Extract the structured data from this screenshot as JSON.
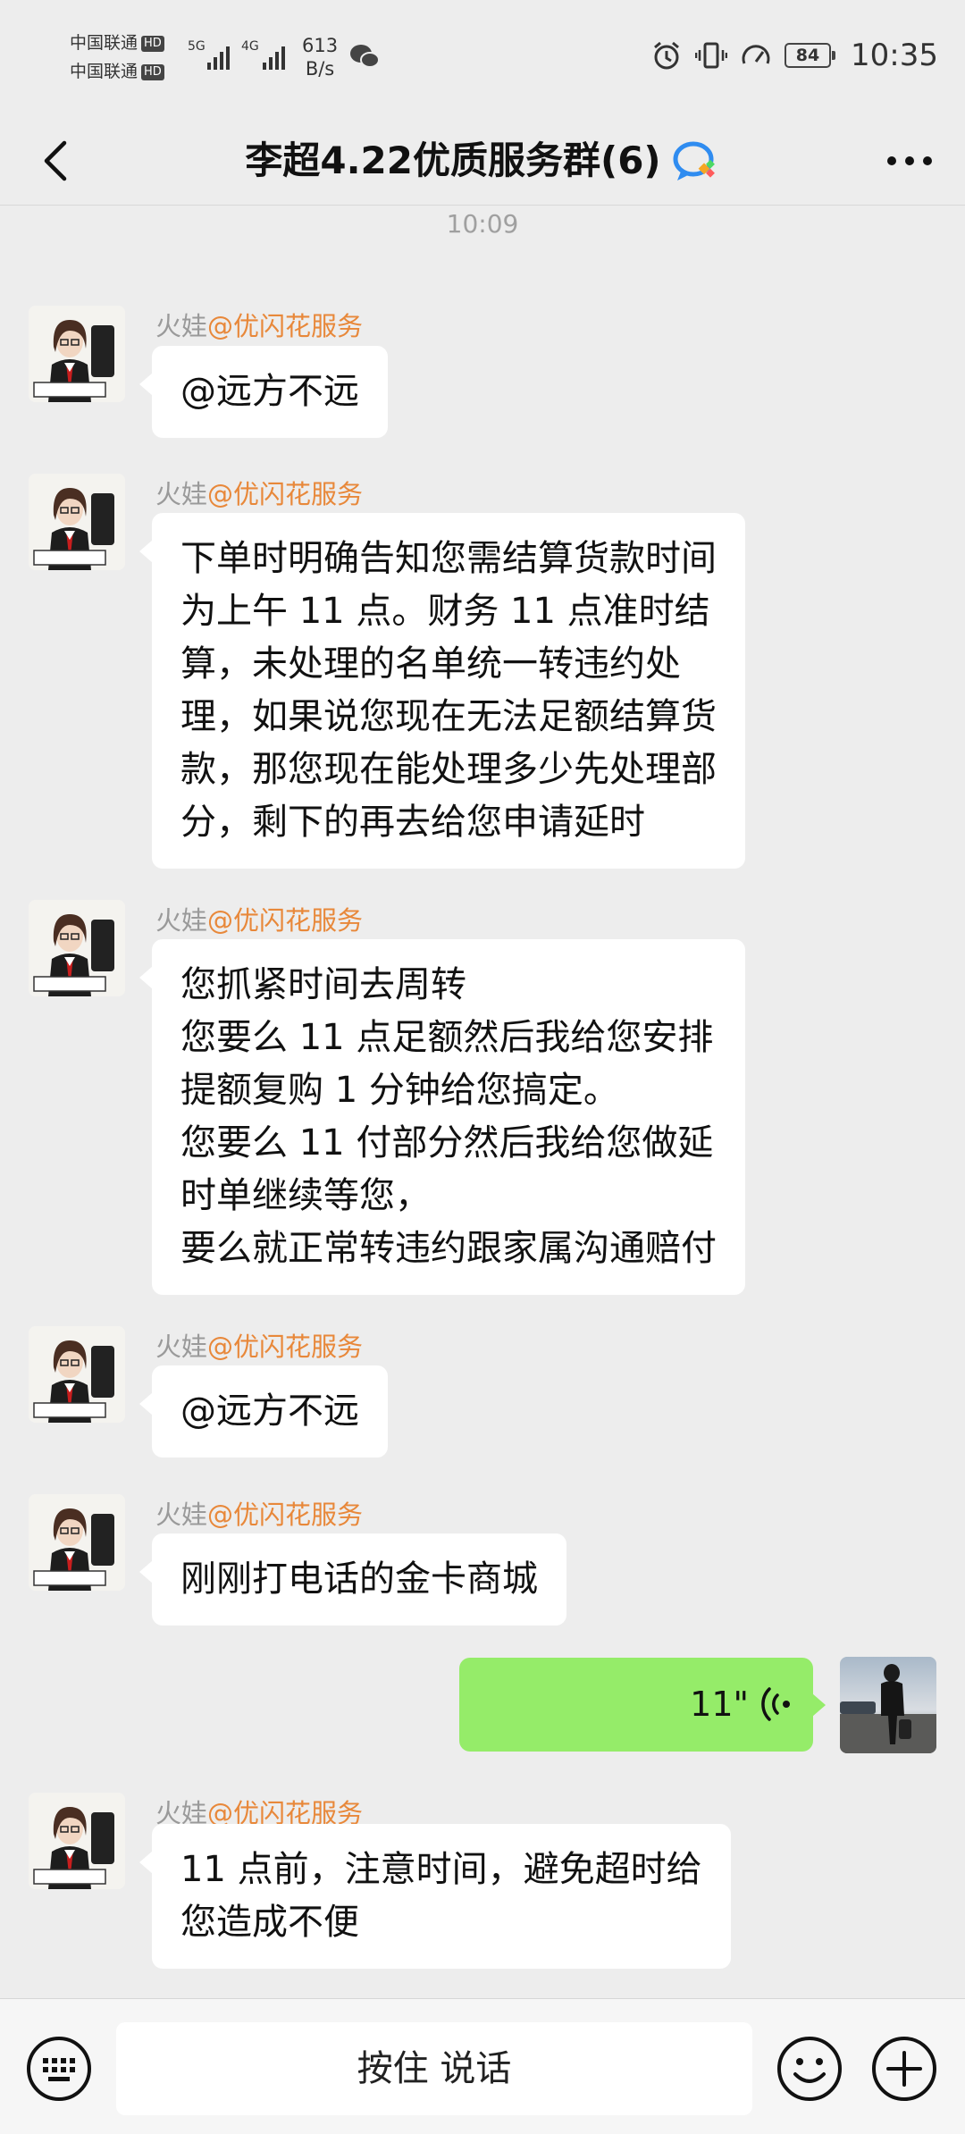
{
  "status_bar": {
    "carrier1": "中国联通",
    "carrier2": "中国联通",
    "hd": "HD",
    "sig1": "5G",
    "sig2": "4G",
    "net_speed_value": "613",
    "net_speed_unit": "B/s",
    "battery": "84",
    "time": "10:35"
  },
  "header": {
    "title": "李超4.22优质服务群(6)"
  },
  "chat": {
    "timestamp": "10:09",
    "messages": [
      {
        "sender": "火娃",
        "sender_tag": "@优闪花服务",
        "lines": [
          "@远方不远"
        ]
      },
      {
        "sender": "火娃",
        "sender_tag": "@优闪花服务",
        "lines": [
          "下单时明确告知您需结算货款时间",
          "为上午 11 点。财务 11 点准时结",
          "算，未处理的名单统一转违约处",
          "理，如果说您现在无法足额结算货",
          "款，那您现在能处理多少先处理部",
          "分，剩下的再去给您申请延时"
        ]
      },
      {
        "sender": "火娃",
        "sender_tag": "@优闪花服务",
        "lines": [
          "您抓紧时间去周转",
          "您要么 11 点足额然后我给您安排",
          "提额复购 1 分钟给您搞定。",
          "您要么 11 付部分然后我给您做延",
          "时单继续等您，",
          "要么就正常转违约跟家属沟通赔付"
        ]
      },
      {
        "sender": "火娃",
        "sender_tag": "@优闪花服务",
        "lines": [
          "@远方不远"
        ]
      },
      {
        "sender": "火娃",
        "sender_tag": "@优闪花服务",
        "lines": [
          "刚刚打电话的金卡商城"
        ]
      },
      {
        "sender": "火娃",
        "sender_tag": "@优闪花服务",
        "lines": [
          "11 点前，注意时间，避免超时给",
          "您造成不便"
        ]
      }
    ],
    "voice": {
      "duration": "11\""
    }
  },
  "input_bar": {
    "hold_to_talk": "按住 说话"
  }
}
